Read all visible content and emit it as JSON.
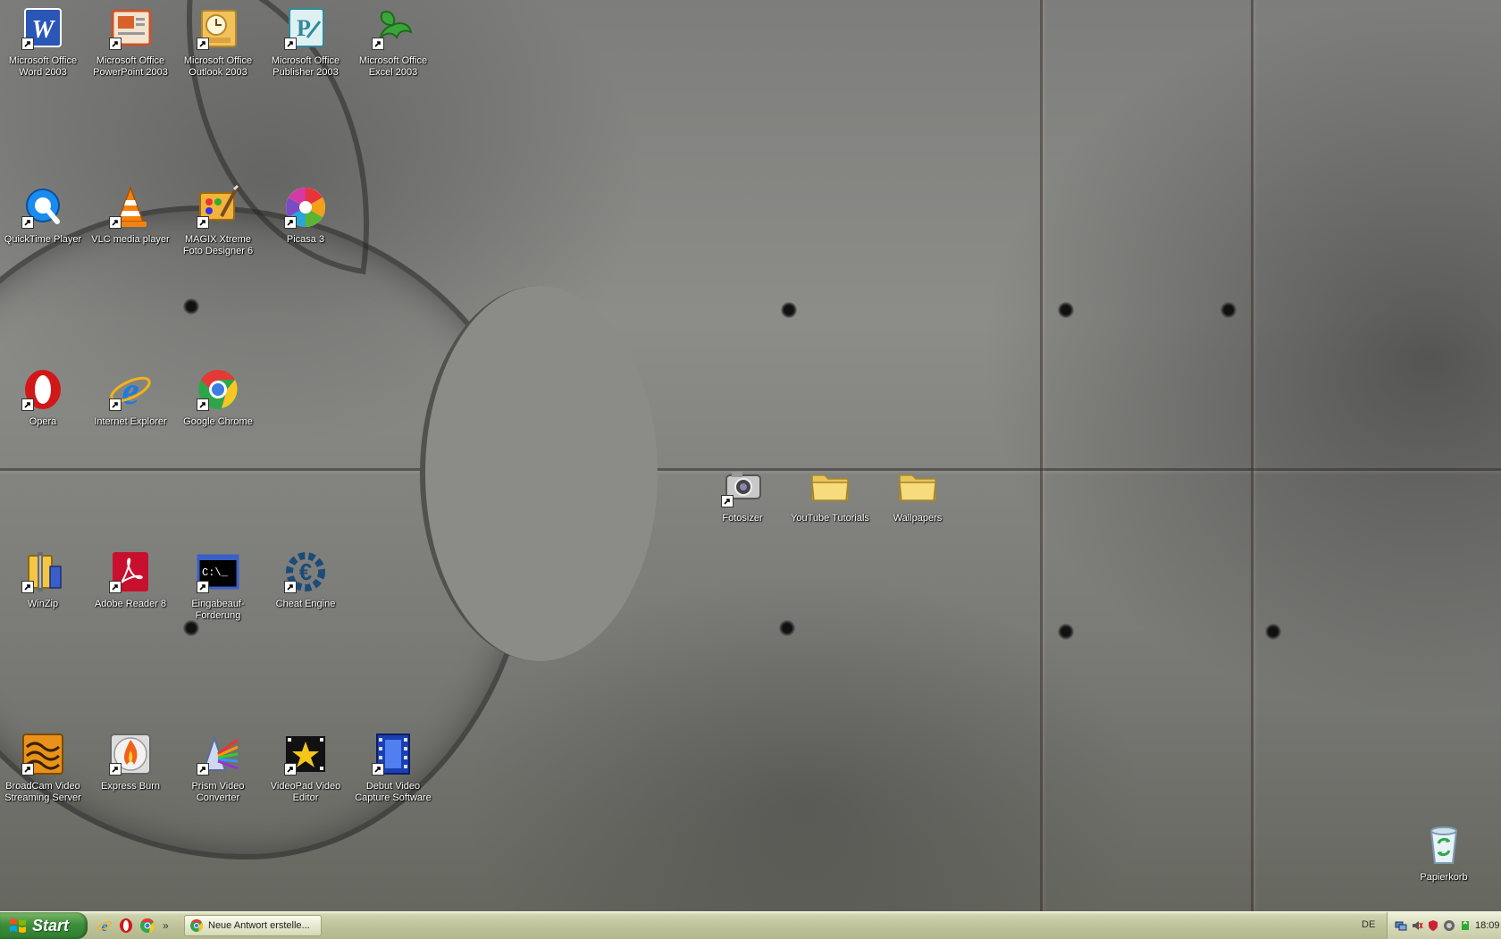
{
  "desktop": {
    "icons": [
      {
        "label": "Microsoft Office Word 2003",
        "icon": "word-icon"
      },
      {
        "label": "Microsoft Office PowerPoint 2003",
        "icon": "powerpoint-icon"
      },
      {
        "label": "Microsoft Office Outlook 2003",
        "icon": "outlook-icon"
      },
      {
        "label": "Microsoft Office Publisher 2003",
        "icon": "publisher-icon"
      },
      {
        "label": "Microsoft Office Excel 2003",
        "icon": "excel-icon"
      },
      {
        "label": "QuickTime Player",
        "icon": "quicktime-icon"
      },
      {
        "label": "VLC media player",
        "icon": "vlc-icon"
      },
      {
        "label": "MAGIX Xtreme Foto Designer 6",
        "icon": "magix-icon"
      },
      {
        "label": "Picasa 3",
        "icon": "picasa-icon"
      },
      {
        "label": "Opera",
        "icon": "opera-icon"
      },
      {
        "label": "Internet Explorer",
        "icon": "internet-explorer-icon"
      },
      {
        "label": "Google Chrome",
        "icon": "chrome-icon"
      },
      {
        "label": "WinZip",
        "icon": "winzip-icon"
      },
      {
        "label": "Adobe Reader 8",
        "icon": "adobe-reader-icon"
      },
      {
        "label": "Eingabeauf-Forderung",
        "icon": "command-prompt-icon"
      },
      {
        "label": "Cheat Engine",
        "icon": "cheat-engine-icon"
      },
      {
        "label": "BroadCam Video Streaming Server",
        "icon": "broadcam-icon"
      },
      {
        "label": "Express Burn",
        "icon": "express-burn-icon"
      },
      {
        "label": "Prism Video Converter",
        "icon": "prism-icon"
      },
      {
        "label": "VideoPad Video Editor",
        "icon": "videopad-icon"
      },
      {
        "label": "Debut Video Capture Software",
        "icon": "debut-icon"
      },
      {
        "label": "Fotosizer",
        "icon": "fotosizer-icon"
      },
      {
        "label": "YouTube Tutorials",
        "icon": "folder-icon"
      },
      {
        "label": "Wallpapers",
        "icon": "folder-icon"
      },
      {
        "label": "Papierkorb",
        "icon": "recycle-bin-icon"
      }
    ]
  },
  "taskbar": {
    "start_label": "Start",
    "quicklaunch": [
      "internet-explorer-icon",
      "opera-icon",
      "chrome-icon"
    ],
    "overflow": "»",
    "window_button": "Neue Antwort erstelle...",
    "language": "DE",
    "clock": "18:09"
  }
}
